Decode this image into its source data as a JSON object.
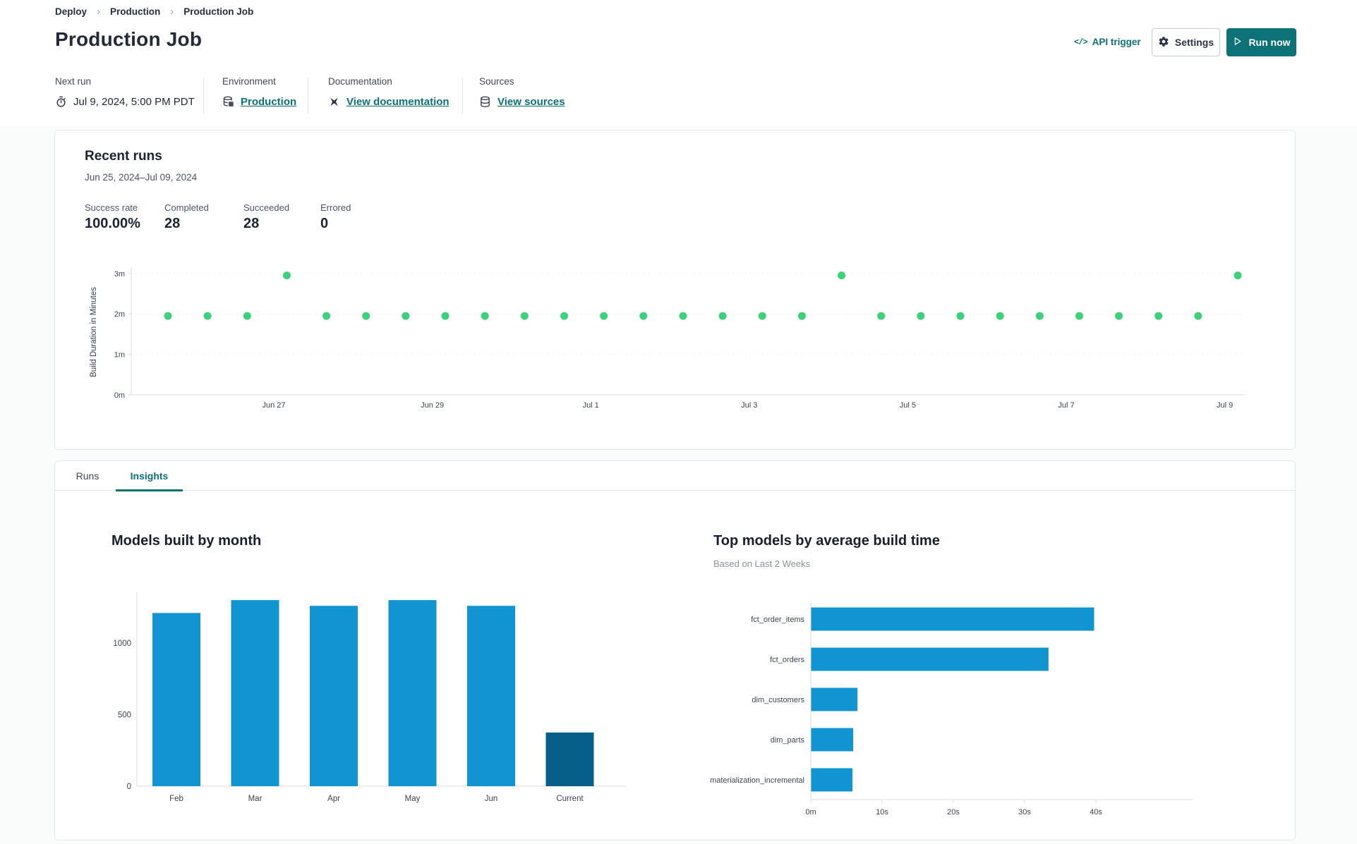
{
  "breadcrumb": {
    "items": [
      "Deploy",
      "Production",
      "Production Job"
    ],
    "separator": "›"
  },
  "header": {
    "title": "Production Job",
    "api_trigger": {
      "icon_text": "</>",
      "label": "API trigger"
    },
    "settings_label": "Settings",
    "run_now_label": "Run now"
  },
  "info_bar": {
    "columns": [
      {
        "label": "Next run",
        "icon": "clock-icon",
        "value": "Jul 9, 2024, 5:00 PM PDT",
        "is_link": false
      },
      {
        "label": "Environment",
        "icon": "environment-database-icon",
        "value": "Production",
        "is_link": true
      },
      {
        "label": "Documentation",
        "icon": "dbt-docs-icon",
        "value": "View documentation",
        "is_link": true
      },
      {
        "label": "Sources",
        "icon": "database-icon",
        "value": "View sources",
        "is_link": true
      }
    ]
  },
  "recent_runs": {
    "title": "Recent runs",
    "date_range": "Jun 25, 2024–Jul 09, 2024",
    "stats": [
      {
        "label": "Success rate",
        "value": "100.00%"
      },
      {
        "label": "Completed",
        "value": "28"
      },
      {
        "label": "Succeeded",
        "value": "28"
      },
      {
        "label": "Errored",
        "value": "0"
      }
    ]
  },
  "tabs": [
    {
      "label": "Runs",
      "active": false
    },
    {
      "label": "Insights",
      "active": true
    }
  ],
  "chart_data": [
    {
      "id": "build-duration-scatter",
      "type": "scatter",
      "ylabel": "Build Duration in Minutes",
      "yticks": [
        {
          "label": "0m",
          "minutes": 0
        },
        {
          "label": "1m",
          "minutes": 1
        },
        {
          "label": "2m",
          "minutes": 2
        },
        {
          "label": "3m",
          "minutes": 3
        }
      ],
      "ylim_minutes": [
        0,
        3.3
      ],
      "xticks": [
        "Jun 27",
        "Jun 29",
        "Jul 1",
        "Jul 3",
        "Jul 5",
        "Jul 7",
        "Jul 9"
      ],
      "points_minutes": [
        1.95,
        1.95,
        1.95,
        2.95,
        1.95,
        1.95,
        1.95,
        1.95,
        1.95,
        1.95,
        1.95,
        1.95,
        1.95,
        1.95,
        1.95,
        1.95,
        1.95,
        2.95,
        1.95,
        1.95,
        1.95,
        1.95,
        1.95,
        1.95,
        1.95,
        1.95,
        1.95,
        2.95
      ],
      "point_color": "#3ed17b",
      "grid": "dotted-horizontal",
      "legend": "none"
    },
    {
      "id": "models-built-by-month",
      "type": "bar",
      "title": "Models built by month",
      "categories": [
        "Feb",
        "Mar",
        "Apr",
        "May",
        "Jun",
        "Current"
      ],
      "values": [
        1210,
        1300,
        1260,
        1300,
        1260,
        375
      ],
      "yticks": [
        0,
        500,
        1000
      ],
      "ylim": [
        0,
        1340
      ],
      "xlabel": "",
      "ylabel": "",
      "bar_color": "#1094d2",
      "highlight_category": "Current",
      "highlight_color": "#055e87",
      "grid": "off",
      "legend": "none"
    },
    {
      "id": "top-models-by-average-build-time",
      "type": "bar-horizontal",
      "title": "Top models by average build time",
      "subtitle": "Based on Last 2 Weeks",
      "categories": [
        "fct_order_items",
        "fct_orders",
        "dim_customers",
        "dim_parts",
        "materialization_incremental"
      ],
      "values_seconds": [
        39.7,
        33.3,
        6.5,
        5.9,
        5.8
      ],
      "xticks": [
        {
          "label": "0m",
          "seconds": 0
        },
        {
          "label": "10s",
          "seconds": 10
        },
        {
          "label": "20s",
          "seconds": 20
        },
        {
          "label": "30s",
          "seconds": 30
        },
        {
          "label": "40s",
          "seconds": 40
        }
      ],
      "xlim_seconds": [
        0,
        44
      ],
      "bar_color": "#1094d2",
      "grid": "off",
      "legend": "none"
    }
  ],
  "colors": {
    "accent_teal": "#0c7276",
    "success_green": "#3ed17b",
    "bar_blue": "#1094d2",
    "bar_dark_blue": "#055e87",
    "text_dark": "#1a2433",
    "text_muted": "#4a5568",
    "border": "#e4e7eb",
    "axis_line": "#d9dde1"
  }
}
